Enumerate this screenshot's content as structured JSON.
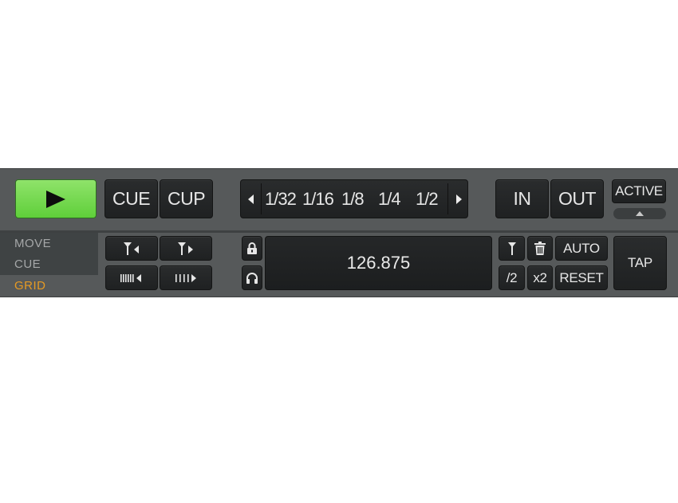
{
  "transport": {
    "cue_label": "CUE",
    "cup_label": "CUP"
  },
  "loop_sizes": [
    "1/32",
    "1/16",
    "1/8",
    "1/4",
    "1/2"
  ],
  "loop": {
    "in_label": "IN",
    "out_label": "OUT",
    "active_label": "ACTIVE"
  },
  "modes": {
    "move": "MOVE",
    "cue": "CUE",
    "grid": "GRID",
    "selected": "GRID"
  },
  "tempo": {
    "bpm": "126.875"
  },
  "grid_controls": {
    "half_label": "/2",
    "double_label": "x2",
    "auto_label": "AUTO",
    "reset_label": "RESET",
    "tap_label": "TAP"
  },
  "colors": {
    "play_green": "#6fd84a",
    "grid_active_orange": "#e69a23",
    "panel_grey": "#56595a"
  },
  "icons": [
    "play-icon",
    "arrow-left-icon",
    "arrow-right-icon",
    "lock-icon",
    "headphones-icon",
    "grid-marker-icon",
    "trash-icon"
  ]
}
